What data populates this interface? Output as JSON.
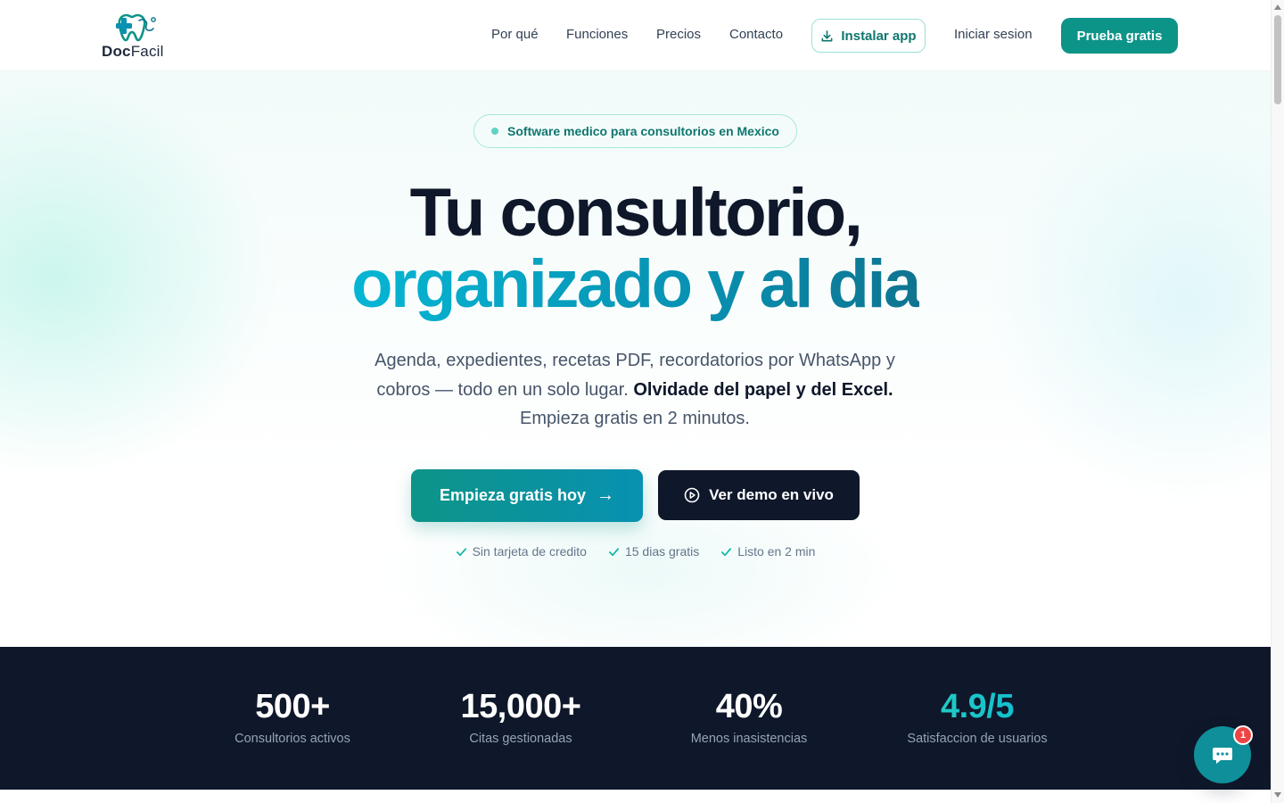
{
  "brand": {
    "name_part1": "Doc",
    "name_part2": "Facil",
    "icon": "tooth-cross-logo-icon",
    "colors": {
      "primary": "#0d9488",
      "accent": "#06b6d4",
      "dark": "#0f172a"
    }
  },
  "nav": {
    "links": [
      "Por qué",
      "Funciones",
      "Precios",
      "Contacto"
    ],
    "install_label": "Instalar app",
    "install_icon": "download-icon",
    "login_label": "Iniciar sesion",
    "trial_label": "Prueba gratis"
  },
  "hero": {
    "badge": "Software medico para consultorios en Mexico",
    "headline_line1": "Tu consultorio,",
    "headline_line2": "organizado y al dia",
    "subtitle_part1": "Agenda, expedientes, recetas PDF, recordatorios por WhatsApp y cobros — todo en un solo lugar.",
    "subtitle_strong": "Olvidade del papel y del Excel.",
    "subtitle_part2": "Empieza gratis en 2 minutos.",
    "cta_primary": "Empieza gratis hoy",
    "cta_primary_arrow": "→",
    "cta_secondary": "Ver demo en vivo",
    "cta_secondary_icon": "play-circle-icon",
    "checks": [
      "Sin tarjeta de credito",
      "15 dias gratis",
      "Listo en 2 min"
    ]
  },
  "stats": [
    {
      "value": "500+",
      "label": "Consultorios activos"
    },
    {
      "value": "15,000+",
      "label": "Citas gestionadas"
    },
    {
      "value": "40%",
      "label": "Menos inasistencias"
    },
    {
      "value": "4.9/5",
      "label": "Satisfaccion de usuarios"
    }
  ],
  "chat": {
    "icon": "chat-bubble-icon",
    "badge_count": "1"
  }
}
